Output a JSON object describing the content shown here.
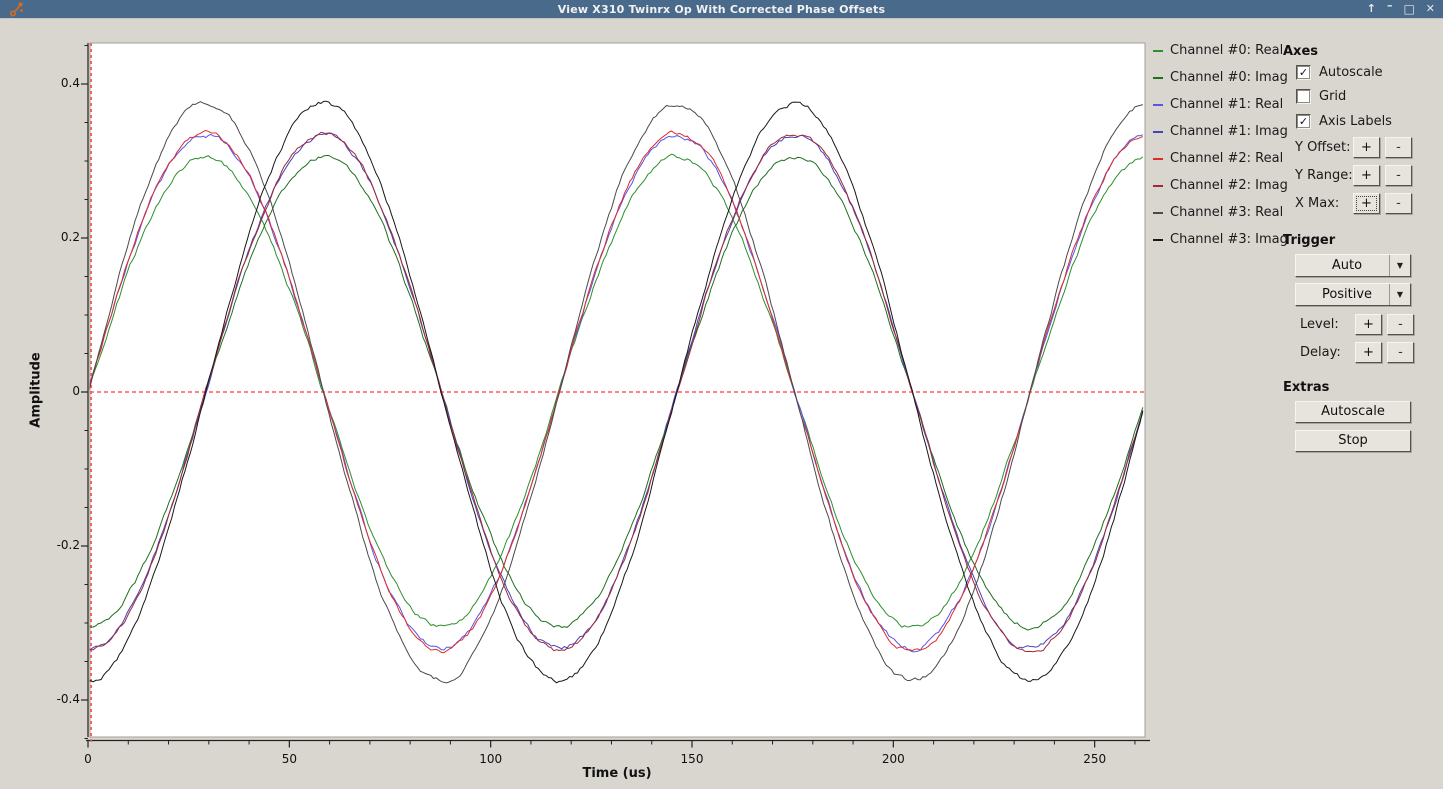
{
  "window": {
    "title": "View X310 Twinrx Op With Corrected Phase Offsets",
    "controls": {
      "shade": "↑",
      "minimize": "–",
      "maximize": "□",
      "close": "✕"
    }
  },
  "icons": {
    "combo_arrow": "▼",
    "checkmark": "✓"
  },
  "chart_data": {
    "type": "line",
    "title": "",
    "xlabel": "Time (us)",
    "ylabel": "Amplitude",
    "xlim": [
      0,
      262.5
    ],
    "ylim": [
      -0.448,
      0.453
    ],
    "xticks": [
      0,
      50,
      100,
      150,
      200,
      250
    ],
    "yticks": [
      0.4,
      0.2,
      0,
      -0.2,
      -0.4
    ],
    "x_minor_step": 10,
    "y_minor_step": 0.05,
    "grid": false,
    "legend_position": "right-outside",
    "waveform": {
      "period_us": 117,
      "tmax_us": 262.5,
      "noise": 0.002
    },
    "series": [
      {
        "name": "Channel #0: Real",
        "color": "#2d8f2d",
        "amplitude": 0.305,
        "phase": "sin"
      },
      {
        "name": "Channel #0: Imag",
        "color": "#1f6f1f",
        "amplitude": 0.305,
        "phase": "-cos"
      },
      {
        "name": "Channel #1: Real",
        "color": "#5555e8",
        "amplitude": 0.333,
        "phase": "sin"
      },
      {
        "name": "Channel #1: Imag",
        "color": "#4343bb",
        "amplitude": 0.333,
        "phase": "-cos"
      },
      {
        "name": "Channel #2: Real",
        "color": "#dd2c2c",
        "amplitude": 0.336,
        "phase": "sin"
      },
      {
        "name": "Channel #2: Imag",
        "color": "#a02838",
        "amplitude": 0.336,
        "phase": "-cos"
      },
      {
        "name": "Channel #3: Real",
        "color": "#4a4a4a",
        "amplitude": 0.375,
        "phase": "sin"
      },
      {
        "name": "Channel #3: Imag",
        "color": "#181818",
        "amplitude": 0.375,
        "phase": "-cos"
      }
    ],
    "trigger_lines": {
      "color": "#ff5c5c",
      "x_us": 0.8,
      "y_level": 0
    }
  },
  "panels": {
    "stepper_plus": "+",
    "stepper_minus": "-",
    "axes": {
      "title": "Axes",
      "checkboxes": [
        {
          "label": "Autoscale",
          "checked": true
        },
        {
          "label": "Grid",
          "checked": false
        },
        {
          "label": "Axis Labels",
          "checked": true
        }
      ],
      "steppers": [
        {
          "label": "Y Offset:"
        },
        {
          "label": "Y Range:"
        },
        {
          "label": "X Max:",
          "focused": true
        }
      ]
    },
    "trigger": {
      "title": "Trigger",
      "mode": "Auto",
      "slope": "Positive",
      "steppers": [
        {
          "label": "Level:"
        },
        {
          "label": "Delay:"
        }
      ]
    },
    "extras": {
      "title": "Extras",
      "buttons": [
        "Autoscale",
        "Stop"
      ]
    }
  }
}
